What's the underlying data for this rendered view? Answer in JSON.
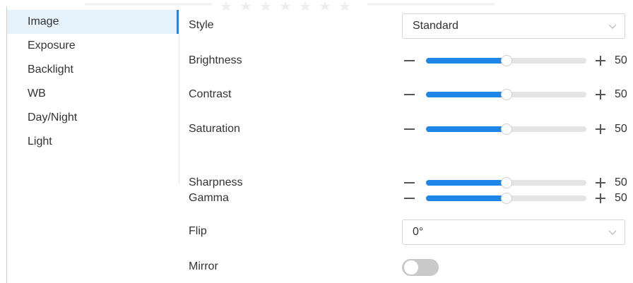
{
  "menu": {
    "items": [
      {
        "label": "Image",
        "active": true
      },
      {
        "label": "Exposure",
        "active": false
      },
      {
        "label": "Backlight",
        "active": false
      },
      {
        "label": "WB",
        "active": false
      },
      {
        "label": "Day/Night",
        "active": false
      },
      {
        "label": "Light",
        "active": false
      }
    ]
  },
  "settings": {
    "style": {
      "label": "Style",
      "value": "Standard"
    },
    "brightness": {
      "label": "Brightness",
      "value": "50",
      "fraction": 0.5
    },
    "contrast": {
      "label": "Contrast",
      "value": "50",
      "fraction": 0.5
    },
    "saturation": {
      "label": "Saturation",
      "value": "50",
      "fraction": 0.5
    },
    "sharpness": {
      "label": "Sharpness",
      "value": "50",
      "fraction": 0.5
    },
    "gamma": {
      "label": "Gamma",
      "value": "50",
      "fraction": 0.5
    },
    "flip": {
      "label": "Flip",
      "value": "0°"
    },
    "mirror": {
      "label": "Mirror",
      "enabled": false
    }
  },
  "colors": {
    "accent": "#1d86e8",
    "active_menu_bg": "#e6f2fc",
    "track": "#e4e4e4",
    "toggle_off": "#c9c9c9"
  }
}
